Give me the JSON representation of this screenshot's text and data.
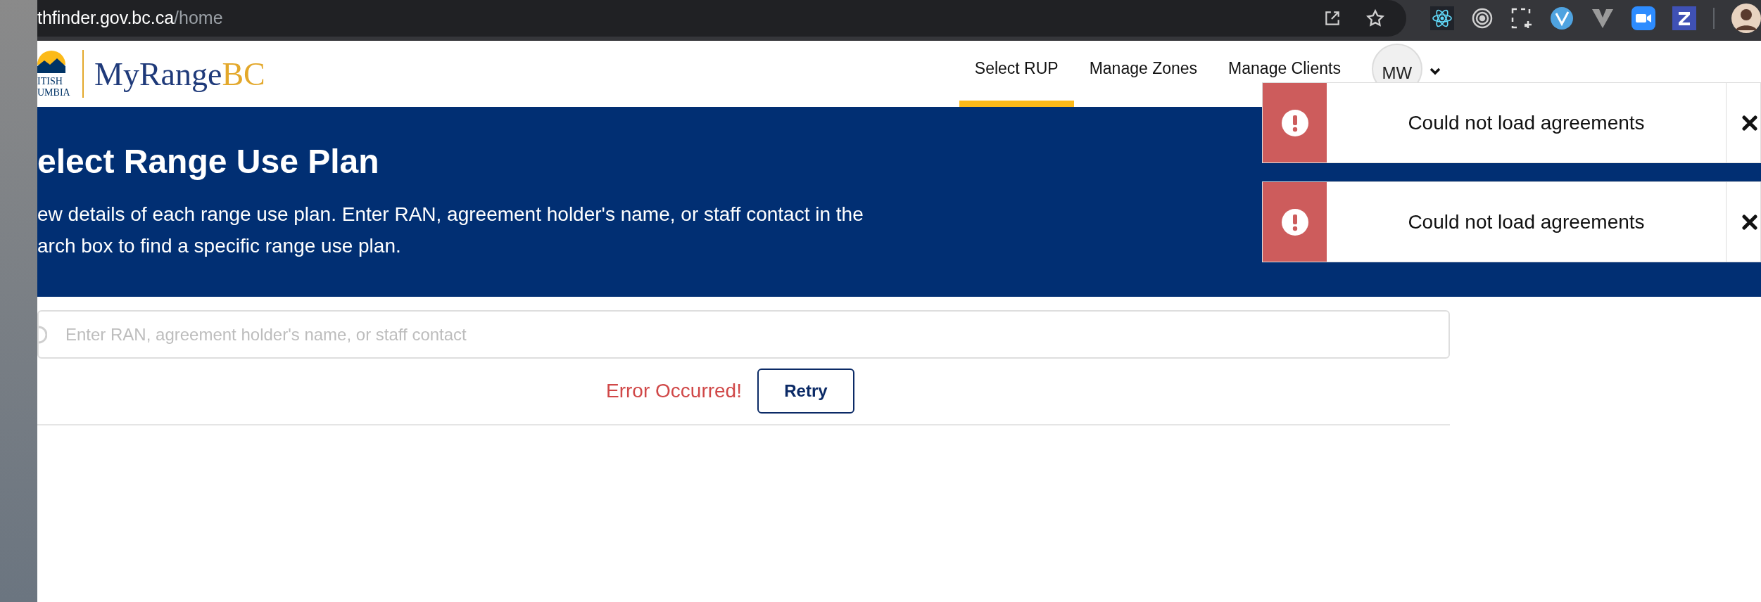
{
  "browser": {
    "url_host": "thfinder.gov.bc.ca",
    "url_path": "/home"
  },
  "header": {
    "logo_lines": [
      "ITISH",
      "UMBIA"
    ],
    "brand": "MyRange",
    "brand_suffix": "BC",
    "user_initials": "MW",
    "nav": [
      {
        "label": "Select RUP",
        "selected": true
      },
      {
        "label": "Manage Zones",
        "selected": false
      },
      {
        "label": "Manage Clients",
        "selected": false
      }
    ]
  },
  "banner": {
    "title": "elect Range Use Plan",
    "description_lines": [
      "ew details of each range use plan. Enter RAN, agreement holder's name, or staff contact in the",
      "arch box to find a specific range use plan."
    ]
  },
  "search": {
    "placeholder": "Enter RAN, agreement holder's name, or staff contact"
  },
  "error": {
    "message": "Error Occurred!",
    "retry_label": "Retry"
  },
  "toasts": [
    {
      "message": "Could not load agreements"
    },
    {
      "message": "Could not load agreements"
    }
  ]
}
